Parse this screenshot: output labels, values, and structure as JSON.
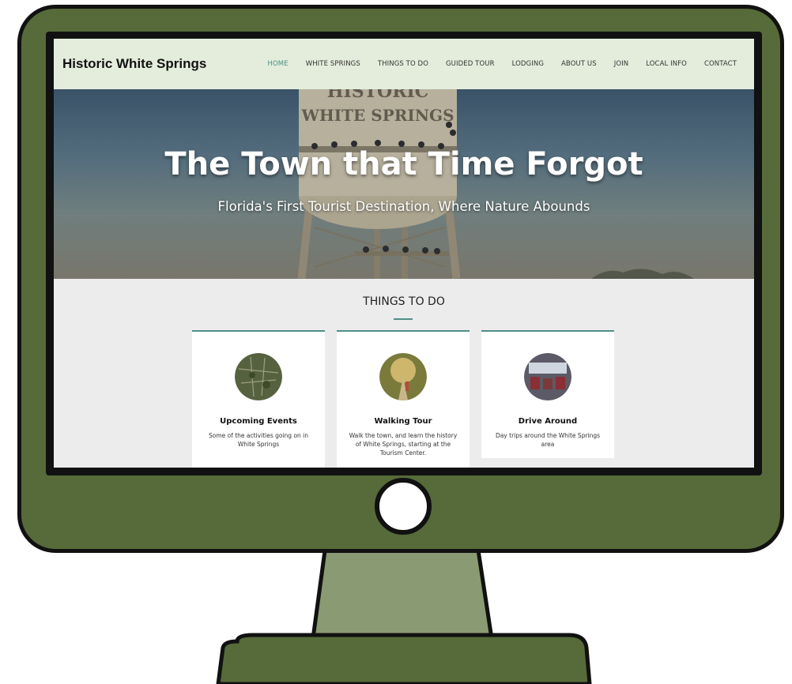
{
  "site": {
    "title": "Historic White Springs",
    "nav": [
      "HOME",
      "WHITE SPRINGS",
      "THINGS TO DO",
      "GUIDED TOUR",
      "LODGING",
      "ABOUT US",
      "JOIN",
      "LOCAL INFO",
      "CONTACT"
    ],
    "active_nav": "HOME"
  },
  "hero": {
    "title": "The Town that Time Forgot",
    "subtitle": "Florida's First Tourist Destination, Where Nature Abounds",
    "tower_text_1": "HISTORIC",
    "tower_text_2": "WHITE SPRINGS"
  },
  "things_to_do": {
    "heading": "THINGS TO DO",
    "cards": [
      {
        "title": "Upcoming Events",
        "description": "Some of the activities going on in White Springs"
      },
      {
        "title": "Walking Tour",
        "description": "Walk the town, and learn the history of White Springs, starting at the Tourism Center."
      },
      {
        "title": "Drive Around",
        "description": "Day trips around the White Springs area"
      }
    ]
  },
  "colors": {
    "monitor": "#566b39",
    "stand": "#8a9a72",
    "header_bg": "#e4eddc",
    "accent": "#4f8f86"
  }
}
